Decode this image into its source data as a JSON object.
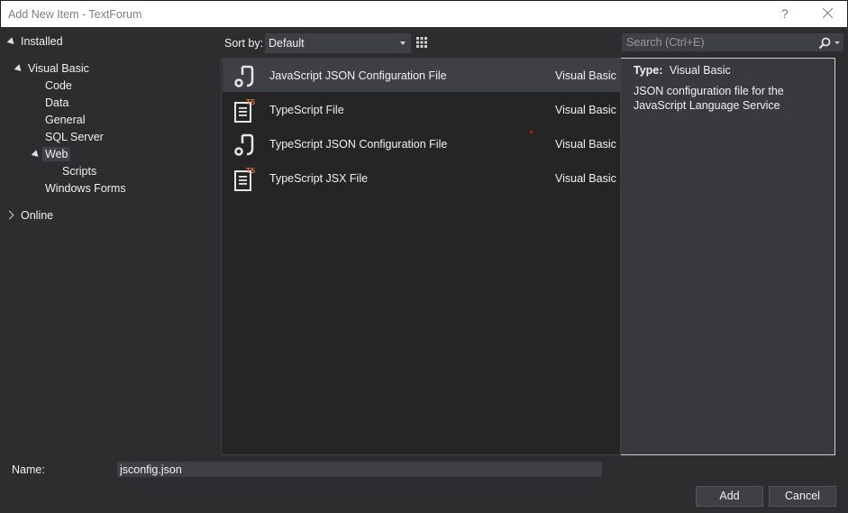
{
  "window": {
    "title": "Add New Item - TextForum",
    "help_label": "?"
  },
  "tree": {
    "installed": "Installed",
    "visual_basic": "Visual Basic",
    "children": [
      "Code",
      "Data",
      "General",
      "SQL Server",
      "Web",
      "Scripts",
      "Windows Forms"
    ],
    "online": "Online",
    "selected": "Web"
  },
  "toolbar": {
    "sort_label": "Sort by:",
    "sort_value": "Default"
  },
  "search": {
    "placeholder": "Search (Ctrl+E)"
  },
  "templates": [
    {
      "name": "JavaScript JSON Configuration File",
      "language": "Visual Basic",
      "icon": "json-config-icon",
      "selected": true
    },
    {
      "name": "TypeScript File",
      "language": "Visual Basic",
      "icon": "typescript-file-icon",
      "selected": false
    },
    {
      "name": "TypeScript JSON Configuration File",
      "language": "Visual Basic",
      "icon": "json-config-icon",
      "selected": false
    },
    {
      "name": "TypeScript JSX File",
      "language": "Visual Basic",
      "icon": "typescript-file-icon",
      "selected": false
    }
  ],
  "details": {
    "type_label": "Type:",
    "type_value": "Visual Basic",
    "description": "JSON configuration file for the JavaScript Language Service"
  },
  "footer": {
    "name_label": "Name:",
    "name_value": "jsconfig.json",
    "add_label": "Add",
    "cancel_label": "Cancel"
  },
  "colors": {
    "background": "#2d2d30",
    "list_background": "#252526",
    "selection": "#3f3f46",
    "ts_orange": "#e8743b"
  }
}
